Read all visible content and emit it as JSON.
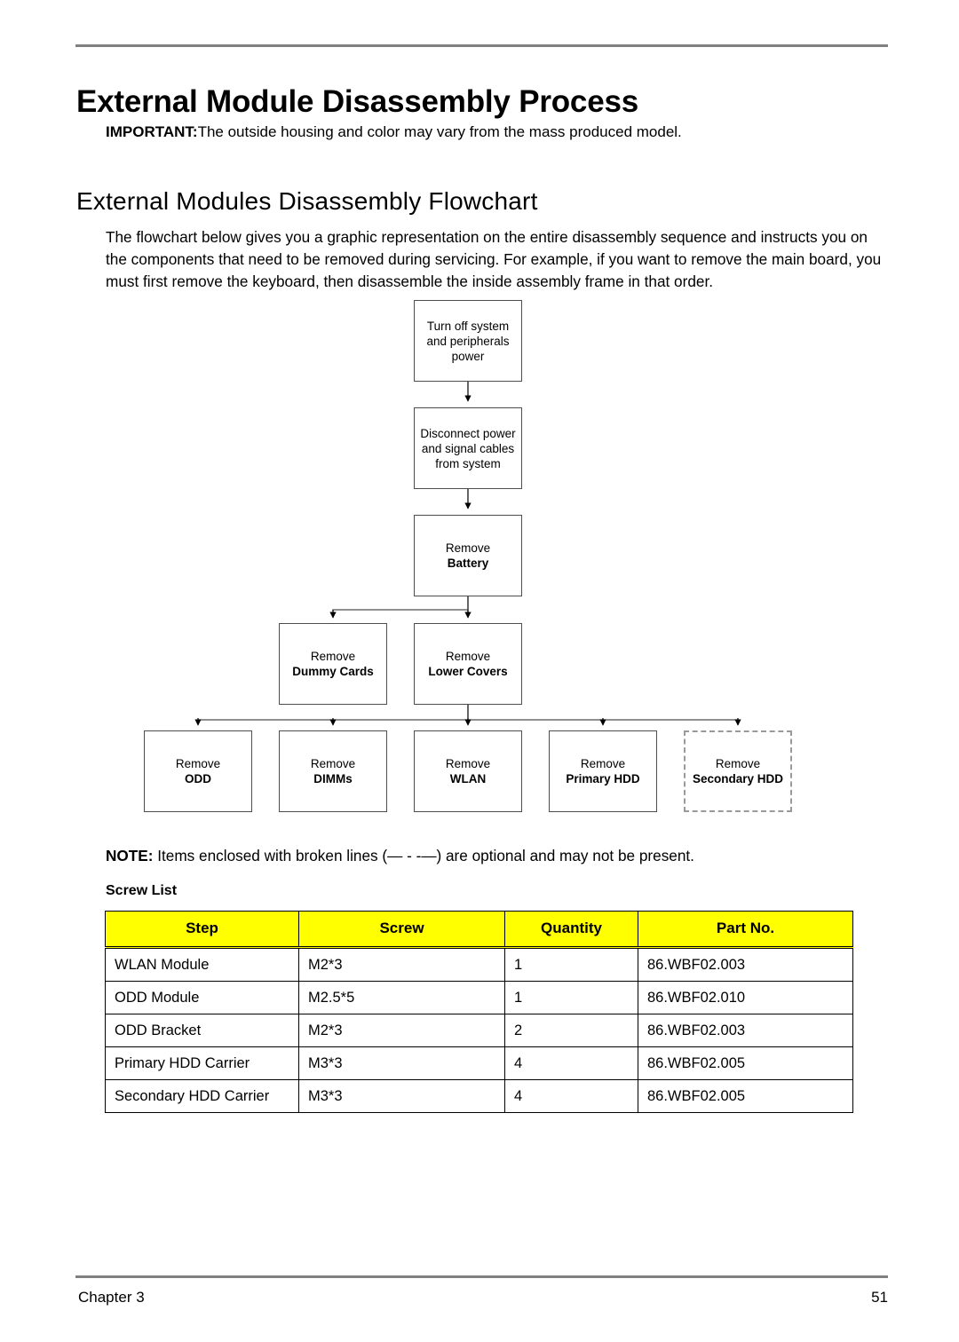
{
  "document": {
    "title": "External Module Disassembly Process",
    "important": {
      "label": "IMPORTANT:",
      "text": "The outside housing and color may vary from the mass produced model."
    },
    "section_heading": "External Modules Disassembly Flowchart",
    "intro_paragraph": "The flowchart below gives you a graphic representation on the entire disassembly sequence and instructs you on the components that need to be removed during servicing. For example, if you want to remove the main board, you must first remove the keyboard, then disassemble the inside assembly frame in that order.",
    "note": {
      "label": "NOTE:",
      "text": " Items enclosed with broken lines (— - -—) are optional and may not be present."
    },
    "screw_list_title": "Screw List"
  },
  "flowchart": {
    "boxes": [
      {
        "id": "power",
        "line1": "Turn off system",
        "line2": "and peripherals",
        "line3": "power",
        "bold": false,
        "optional": false
      },
      {
        "id": "disconnect",
        "line1": "Disconnect power",
        "line2": "and signal cables",
        "line3": "from system",
        "bold": false,
        "optional": false
      },
      {
        "id": "battery",
        "line1": "Remove",
        "line2": "Battery",
        "bold": true,
        "optional": false
      },
      {
        "id": "dummy",
        "line1": "Remove",
        "line2": "Dummy Cards",
        "bold": true,
        "optional": false
      },
      {
        "id": "lower",
        "line1": "Remove",
        "line2": "Lower Covers",
        "bold": true,
        "optional": false
      },
      {
        "id": "odd",
        "line1": "Remove",
        "line2": "ODD",
        "bold": true,
        "optional": false
      },
      {
        "id": "dimms",
        "line1": "Remove",
        "line2": "DIMMs",
        "bold": true,
        "optional": false
      },
      {
        "id": "wlan",
        "line1": "Remove",
        "line2": "WLAN",
        "bold": true,
        "optional": false
      },
      {
        "id": "phdd",
        "line1": "Remove",
        "line2": "Primary HDD",
        "bold": true,
        "optional": false
      },
      {
        "id": "shdd",
        "line1": "Remove",
        "line2": "Secondary HDD",
        "bold": true,
        "optional": true
      }
    ],
    "box_text": {
      "power_l1": "Turn off system",
      "power_l2": "and peripherals",
      "power_l3": "power",
      "disconnect_l1": "Disconnect power",
      "disconnect_l2": "and signal cables",
      "disconnect_l3": "from system",
      "battery_l1": "Remove",
      "battery_l2": "Battery",
      "dummy_l1": "Remove",
      "dummy_l2": "Dummy Cards",
      "lower_l1": "Remove",
      "lower_l2": "Lower Covers",
      "odd_l1": "Remove",
      "odd_l2": "ODD",
      "dimms_l1": "Remove",
      "dimms_l2": "DIMMs",
      "wlan_l1": "Remove",
      "wlan_l2": "WLAN",
      "phdd_l1": "Remove",
      "phdd_l2": "Primary HDD",
      "shdd_l1": "Remove",
      "shdd_l2": "Secondary HDD"
    }
  },
  "screw_table": {
    "headers": [
      "Step",
      "Screw",
      "Quantity",
      "Part No."
    ],
    "header_bg": "#FFFF00",
    "rows": [
      {
        "step": "WLAN Module",
        "screw": "M2*3",
        "quantity": "1",
        "part_no": "86.WBF02.003"
      },
      {
        "step": "ODD Module",
        "screw": "M2.5*5",
        "quantity": "1",
        "part_no": "86.WBF02.010"
      },
      {
        "step": "ODD Bracket",
        "screw": "M2*3",
        "quantity": "2",
        "part_no": "86.WBF02.003"
      },
      {
        "step": "Primary HDD Carrier",
        "screw": "M3*3",
        "quantity": "4",
        "part_no": "86.WBF02.005"
      },
      {
        "step": "Secondary HDD Carrier",
        "screw": "M3*3",
        "quantity": "4",
        "part_no": "86.WBF02.005"
      }
    ]
  },
  "footer": {
    "chapter": "Chapter 3",
    "page_number": "51"
  }
}
